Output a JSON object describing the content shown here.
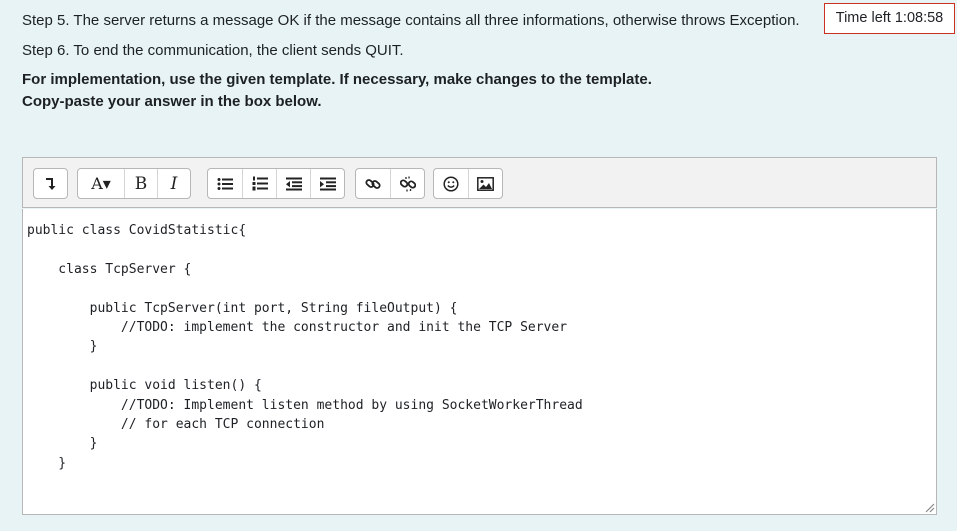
{
  "instructions": {
    "step5": "Step 5. The server returns a message OK if the message contains all three informations, otherwise throws Exception.",
    "step6": "Step 6. To end the communication, the client sends QUIT.",
    "implementation_note": "For implementation, use the given template. If necessary, make changes to the template.",
    "answer_note": "Copy-paste your answer in the box below."
  },
  "timer": {
    "text": "Time left 1:08:58"
  },
  "toolbar": {
    "groups": [
      {
        "buttons": [
          {
            "icon": "collapse-icon",
            "label": "↴"
          }
        ]
      },
      {
        "buttons": [
          {
            "icon": "paragraph-styles-icon",
            "label": "A▾"
          },
          {
            "icon": "bold-icon",
            "label": "B"
          },
          {
            "icon": "italic-icon",
            "label": "I"
          }
        ]
      },
      {
        "buttons": [
          {
            "icon": "unordered-list-icon"
          },
          {
            "icon": "ordered-list-icon"
          },
          {
            "icon": "outdent-icon"
          },
          {
            "icon": "indent-icon"
          }
        ]
      },
      {
        "buttons": [
          {
            "icon": "link-icon"
          },
          {
            "icon": "unlink-icon"
          }
        ]
      },
      {
        "buttons": [
          {
            "icon": "emoticon-icon"
          },
          {
            "icon": "image-icon"
          }
        ]
      }
    ]
  },
  "editor": {
    "content": "public class CovidStatistic{\n\n    class TcpServer {\n\n        public TcpServer(int port, String fileOutput) {\n            //TODO: implement the constructor and init the TCP Server\n        }\n\n        public void listen() {\n            //TODO: Implement listen method by using SocketWorkerThread\n            // for each TCP connection\n        }\n    }"
  },
  "colors": {
    "panel_background": "#e7f3f5",
    "timer_border": "#ca3120",
    "toolbar_background": "#f2f2f2",
    "border": "#b7b7b7"
  }
}
